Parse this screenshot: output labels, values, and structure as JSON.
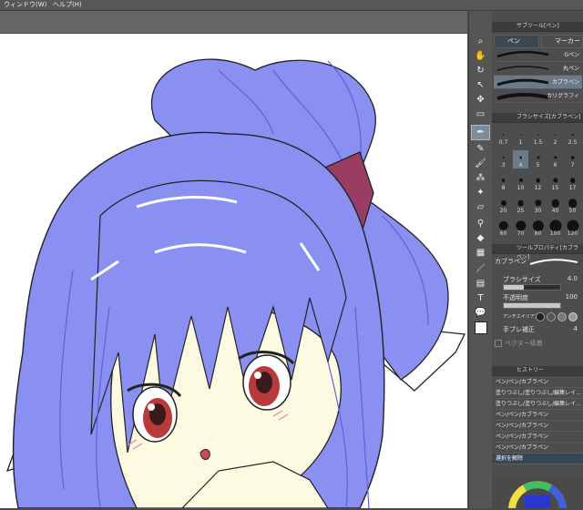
{
  "menubar": {
    "window": "ウィンドウ(W)",
    "help": "ヘルプ(H)"
  },
  "subtool_panel": {
    "title": "サブツール[ペン]",
    "tabs": [
      "ペン",
      "マーカー"
    ],
    "brushes": [
      "Gペン",
      "丸ペン",
      "カブラペン",
      "カリグラフィ"
    ],
    "selected_brush": "カブラペン"
  },
  "brush_size_panel": {
    "title": "ブラシサイズ[カブラペン]",
    "sizes": [
      "0.7",
      "1",
      "1.5",
      "2",
      "2.5",
      "3",
      "4",
      "5",
      "6",
      "7",
      "8",
      "10",
      "12",
      "15",
      "17",
      "20",
      "25",
      "30",
      "40",
      "50",
      "60",
      "70",
      "80",
      "100",
      "120"
    ],
    "selected_size": "4"
  },
  "tool_property_panel": {
    "title": "ツールプロパティ[カブラペン]",
    "brush_name": "カブラペン",
    "size_label": "ブラシサイズ",
    "size_value": "4.0",
    "size_fraction": 0.35,
    "opacity_label": "不透明度",
    "opacity_value": "100",
    "opacity_fraction": 1.0,
    "antialias_label": "アンチエイリアス",
    "stabilization_label": "手ブレ補正",
    "stabilization_value": "4",
    "vector_label": "ベクター吸着"
  },
  "history_panel": {
    "title": "ヒストリー",
    "items": [
      "ペン/ペン/カブラペン",
      "塗りつぶし/塗りつぶし/編集レイ…",
      "塗りつぶし/塗りつぶし/編集レイ…",
      "ペン/ペン/カブラペン",
      "ペン/ペン/カブラペン",
      "ペン/ペン/カブラペン",
      "ペン/ペン/カブラペン",
      "選択を解除"
    ],
    "selected_index": 7
  },
  "colors": {
    "hair": "#8a8ff2",
    "hair_dark": "#5d62d8",
    "skin": "#fcfbe2",
    "ribbon": "#9a3d63",
    "eye": "#b83a3a",
    "accent_panel": "#6b7a88",
    "history_selected": "#364655"
  },
  "toolbar_icons": [
    "zoom-icon",
    "hand-icon",
    "rotate-icon",
    "operation-icon",
    "move-icon",
    "selection-icon",
    "lasso-icon",
    "eyedropper-icon",
    "pen-icon",
    "pencil-icon",
    "brush-icon",
    "airbrush-icon",
    "decoration-icon",
    "eraser-icon",
    "fill-icon",
    "gradient-icon",
    "figure-icon",
    "frame-icon",
    "ruler-icon",
    "text-icon",
    "balloon-icon",
    "line-fix-icon"
  ]
}
